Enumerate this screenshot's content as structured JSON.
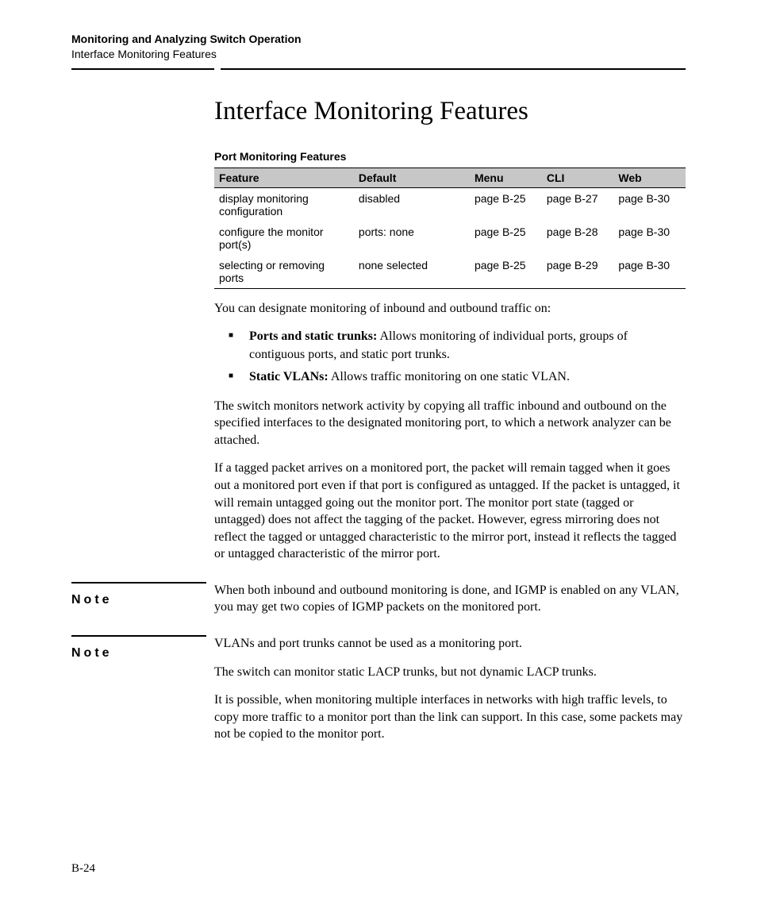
{
  "header": {
    "chapter": "Monitoring and Analyzing Switch Operation",
    "section": "Interface Monitoring Features"
  },
  "title": "Interface Monitoring Features",
  "table": {
    "caption": "Port Monitoring Features",
    "headers": {
      "feature": "Feature",
      "default": "Default",
      "menu": "Menu",
      "cli": "CLI",
      "web": "Web"
    },
    "rows": [
      {
        "feature": "display monitoring configuration",
        "default": "disabled",
        "menu": "page B-25",
        "cli": "page B-27",
        "web": "page B-30"
      },
      {
        "feature": "configure the monitor port(s)",
        "default": "ports: none",
        "menu": "page B-25",
        "cli": "page B-28",
        "web": "page B-30"
      },
      {
        "feature": "selecting or removing ports",
        "default": "none selected",
        "menu": "page B-25",
        "cli": "page B-29",
        "web": "page B-30"
      }
    ]
  },
  "intro": "You can designate monitoring of inbound and outbound traffic on:",
  "bullets": [
    {
      "lead": "Ports and static trunks:",
      "rest": " Allows monitoring of individual ports, groups of contiguous ports, and static port trunks."
    },
    {
      "lead": "Static VLANs:",
      "rest": " Allows traffic monitoring on one static VLAN."
    }
  ],
  "para1": "The switch monitors network activity by copying all traffic inbound and outbound on the specified interfaces to the designated monitoring port, to which a network analyzer can be attached.",
  "para2": "If a tagged packet arrives on a monitored port, the packet will remain tagged when it goes out a monitored port even if that port is configured as untagged. If the packet is untagged, it will remain untagged going out the monitor port. The monitor port state (tagged or untagged) does not affect the tagging of the packet. However, egress mirroring does not reflect the tagged or untagged characteristic to the mirror port, instead it reflects the tagged or untagged characteristic of the mirror port.",
  "note1": {
    "label": "Note",
    "text": "When both inbound and outbound monitoring is done, and IGMP is enabled on any VLAN, you may get two copies of IGMP packets on the monitored port."
  },
  "note2": {
    "label": "Note",
    "text": "VLANs and port trunks cannot be used as a monitoring port."
  },
  "para3": "The switch can monitor static LACP trunks, but not dynamic LACP trunks.",
  "para4": "It is possible, when monitoring multiple interfaces in networks with high traffic levels, to copy more traffic to a monitor port than the link can support. In this case, some packets may not be copied to the monitor port.",
  "pageNumber": "B-24"
}
